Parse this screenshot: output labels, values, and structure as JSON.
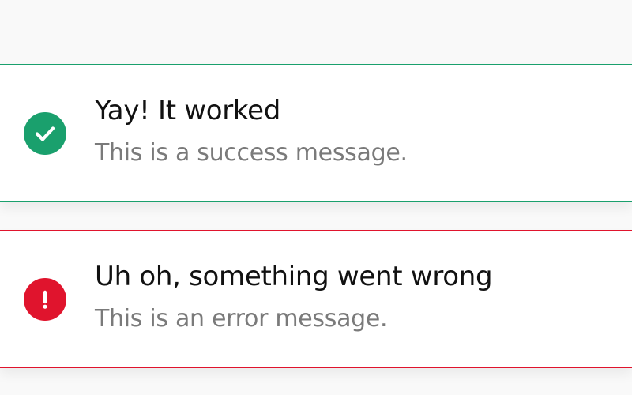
{
  "notifications": {
    "success": {
      "title": "Yay! It worked",
      "message": "This is a success message.",
      "icon": "check-circle-icon",
      "color": "#1aa06d"
    },
    "error": {
      "title": "Uh oh, something went wrong",
      "message": "This is an error message.",
      "icon": "exclamation-circle-icon",
      "color": "#e0142d"
    }
  }
}
